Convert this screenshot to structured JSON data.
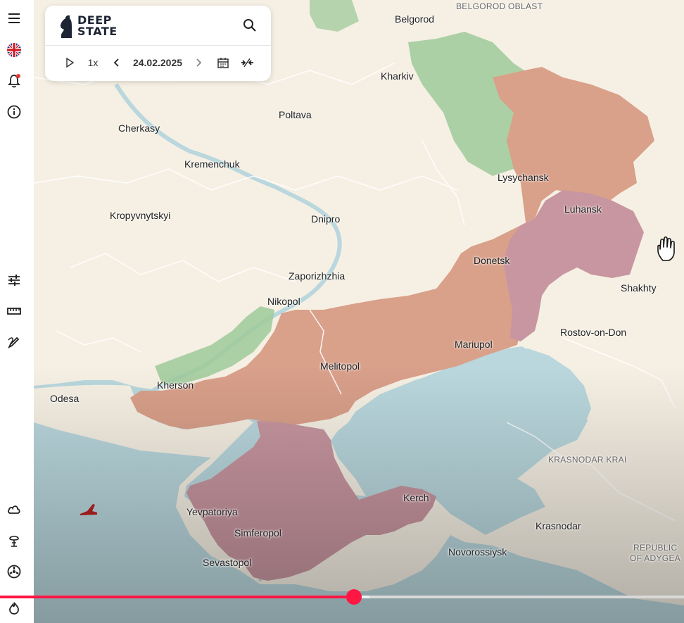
{
  "brand": {
    "line1": "DEEP",
    "line2": "STATE"
  },
  "controls": {
    "speed": "1x",
    "date": "24.02.2025"
  },
  "timeline": {
    "progress": 0.517
  },
  "colors": {
    "land": "#f6f0e4",
    "sea": "#b9d7dd",
    "occupied": "#d9a08a",
    "occupied_pre2022": "#c896a0",
    "liberated": "#9fca9a",
    "timeline_played": "#ff1744",
    "timeline_rest": "#d9d9d9"
  },
  "sidebar": {
    "top_icons": [
      "menu-icon",
      "uk-flag-icon",
      "bell-icon",
      "info-icon"
    ],
    "middle_icons": [
      "sliders-icon",
      "ruler-icon",
      "draw-icon"
    ],
    "bottom_icons": [
      "cloud-icon",
      "explosion-icon",
      "radiation-icon",
      "fire-icon"
    ]
  },
  "map_labels": {
    "belgorod_oblast": "BELGOROD OBLAST",
    "belgorod": "Belgorod",
    "kharkiv": "Kharkiv",
    "poltava": "Poltava",
    "cherkasy": "Cherkasy",
    "kremenchuk": "Kremenchuk",
    "lysychansk": "Lysychansk",
    "luhansk": "Luhansk",
    "kropyvnytskyi": "Kropyvnytskyi",
    "dnipro": "Dnipro",
    "donetsk": "Donetsk",
    "zaporizhzhia": "Zaporizhzhia",
    "shakhty": "Shakhty",
    "nikopol": "Nikopol",
    "rostov": "Rostov-on-Don",
    "mariupol": "Mariupol",
    "melitopol": "Melitopol",
    "kherson": "Kherson",
    "odesa": "Odesa",
    "krasnodar_krai": "KRASNODAR KRAI",
    "kerch": "Kerch",
    "yevpatoriya": "Yevpatoriya",
    "krasnodar": "Krasnodar",
    "simferopol": "Simferopol",
    "adygea_1": "REPUBLIC",
    "adygea_2": "OF ADYGEA",
    "novorossiysk": "Novorossiysk",
    "sevastopol": "Sevastopol"
  }
}
